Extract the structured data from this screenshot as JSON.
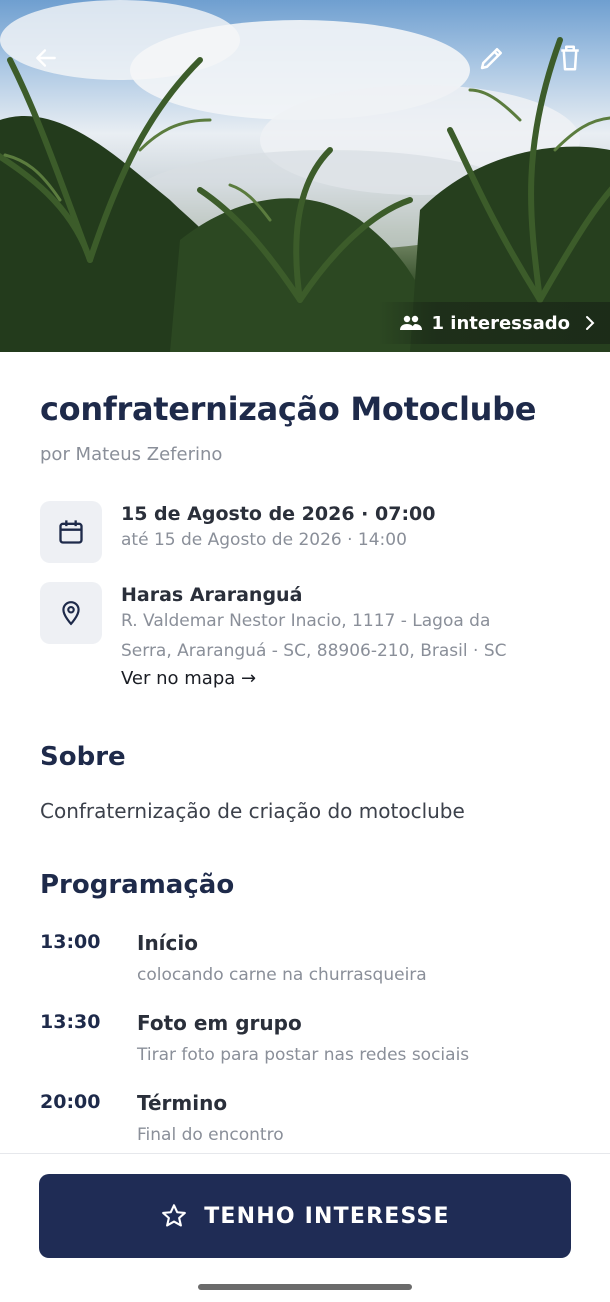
{
  "event": {
    "interested_label": "1 interessado",
    "title": "confraternização Motoclube",
    "organizer": "por Mateus Zeferino",
    "date_main": "15 de Agosto de 2026 · 07:00",
    "date_end": "até 15 de Agosto de 2026 · 14:00",
    "venue_name": "Haras Araranguá",
    "venue_address_line1": "R. Valdemar Nestor Inacio, 1117 - Lagoa da",
    "venue_address_line2": "Serra, Araranguá - SC, 88906-210, Brasil · SC",
    "map_link": "Ver no mapa →"
  },
  "about": {
    "heading": "Sobre",
    "text": "Confraternização de criação do motoclube"
  },
  "schedule": {
    "heading": "Programação",
    "items": [
      {
        "time": "13:00",
        "title": "Início",
        "desc": "colocando carne na churrasqueira"
      },
      {
        "time": "13:30",
        "title": "Foto em grupo",
        "desc": "Tirar foto para postar nas redes sociais"
      },
      {
        "time": "20:00",
        "title": "Término",
        "desc": "Final do encontro"
      }
    ]
  },
  "cta": {
    "label": "TENHO INTERESSE"
  },
  "icons": {
    "back": "arrow-left-icon",
    "edit": "pencil-icon",
    "delete": "trash-icon",
    "people": "people-icon",
    "calendar": "calendar-icon",
    "location": "map-pin-icon",
    "star": "star-outline-icon"
  },
  "colors": {
    "primary": "#1f2c55",
    "title": "#1e2a4a",
    "muted": "#8a8f99",
    "icon_bg": "#eef0f4"
  }
}
